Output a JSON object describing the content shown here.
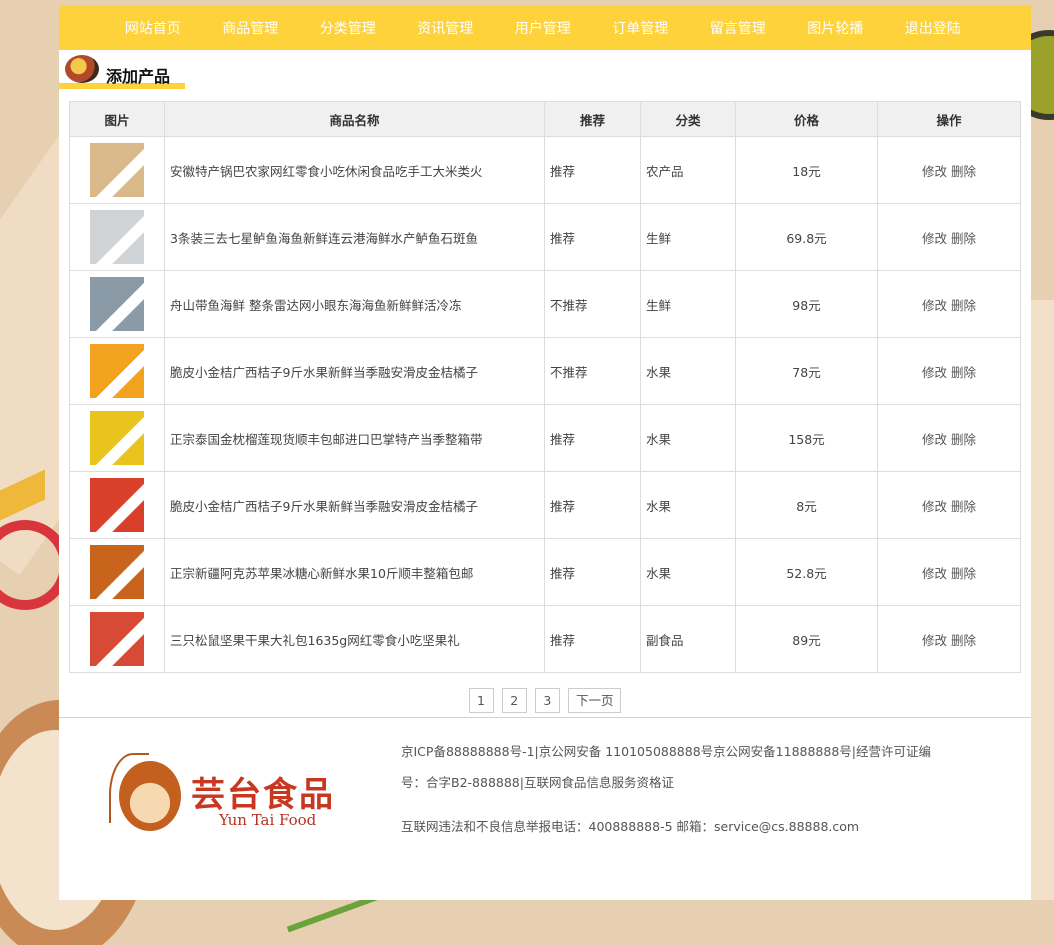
{
  "nav": {
    "items": [
      "网站首页",
      "商品管理",
      "分类管理",
      "资讯管理",
      "用户管理",
      "订单管理",
      "留言管理",
      "图片轮播",
      "退出登陆"
    ]
  },
  "heading": {
    "title": "添加产品"
  },
  "table": {
    "headers": [
      "图片",
      "商品名称",
      "推荐",
      "分类",
      "价格",
      "操作"
    ],
    "rows": [
      {
        "name": "安徽特产锅巴农家网红零食小吃休闲食品吃手工大米类火",
        "recommend": "推荐",
        "category": "农产品",
        "price": "18元",
        "thumb_color": "#d9b98a"
      },
      {
        "name": "3条装三去七星鲈鱼海鱼新鲜连云港海鲜水产鲈鱼石斑鱼",
        "recommend": "推荐",
        "category": "生鲜",
        "price": "69.8元",
        "thumb_color": "#cfd3d6"
      },
      {
        "name": "舟山带鱼海鲜 整条雷达网小眼东海海鱼新鲜鲜活冷冻",
        "recommend": "不推荐",
        "category": "生鲜",
        "price": "98元",
        "thumb_color": "#8a9aa6"
      },
      {
        "name": "脆皮小金桔广西桔子9斤水果新鲜当季融安滑皮金桔橘子",
        "recommend": "不推荐",
        "category": "水果",
        "price": "78元",
        "thumb_color": "#f2a21e"
      },
      {
        "name": "正宗泰国金枕榴莲现货顺丰包邮进口巴掌特产当季整箱带",
        "recommend": "推荐",
        "category": "水果",
        "price": "158元",
        "thumb_color": "#e9c41c"
      },
      {
        "name": "脆皮小金桔广西桔子9斤水果新鲜当季融安滑皮金桔橘子",
        "recommend": "推荐",
        "category": "水果",
        "price": "8元",
        "thumb_color": "#d8402c"
      },
      {
        "name": "正宗新疆阿克苏苹果冰糖心新鲜水果10斤顺丰整箱包邮",
        "recommend": "推荐",
        "category": "水果",
        "price": "52.8元",
        "thumb_color": "#c8641c"
      },
      {
        "name": "三只松鼠坚果干果大礼包1635g网红零食小吃坚果礼",
        "recommend": "推荐",
        "category": "副食品",
        "price": "89元",
        "thumb_color": "#d64a36"
      }
    ],
    "edit_label": "修改",
    "delete_label": "删除"
  },
  "pager": {
    "pages": [
      "1",
      "2",
      "3"
    ],
    "next_label": "下一页"
  },
  "footer": {
    "logo_cn": "芸台食品",
    "logo_en": "Yun Tai Food",
    "line1": "京ICP备88888888号-1|京公网安备 110105088888号京公网安备11888888号|经营许可证编号：合字B2-888888|互联网食品信息服务资格证",
    "line2": "互联网违法和不良信息举报电话：400888888-5 邮箱：service@cs.88888.com"
  }
}
